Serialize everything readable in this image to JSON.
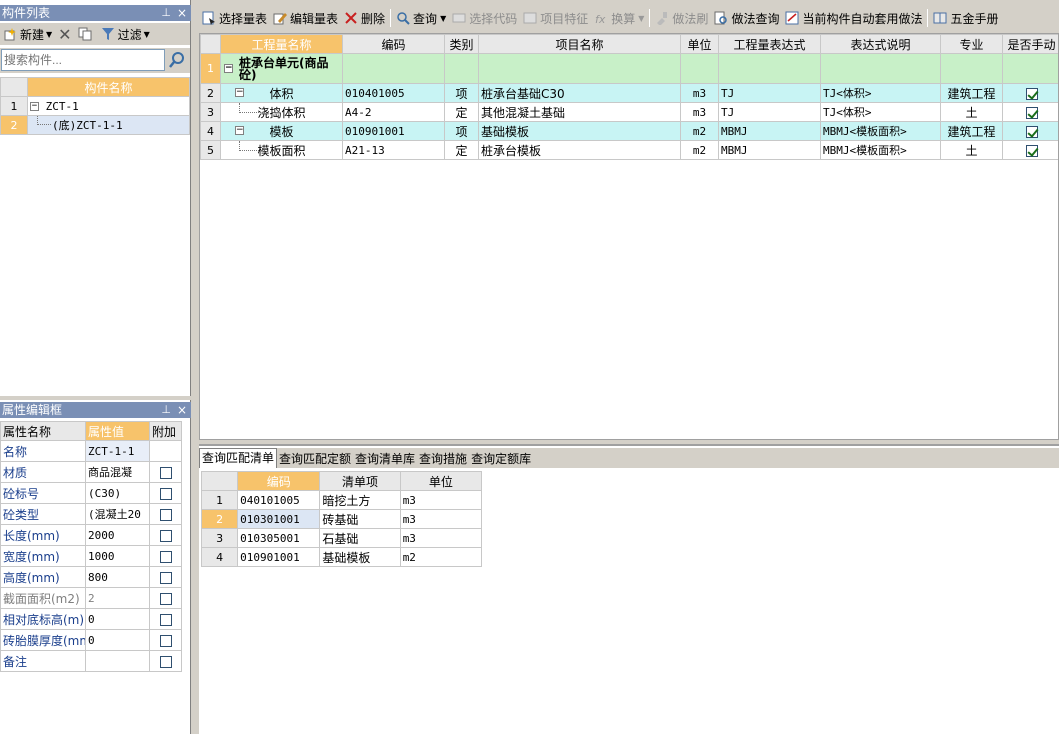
{
  "left_panel": {
    "title": "构件列表",
    "pin": "⊥",
    "close": "×",
    "toolbar": {
      "new_label": "新建",
      "filter_label": "过滤"
    },
    "search_placeholder": "搜索构件...",
    "column_header": "构件名称",
    "tree": [
      {
        "num": "1",
        "label": "ZCT-1"
      },
      {
        "num": "2",
        "label": "(底)ZCT-1-1"
      }
    ]
  },
  "prop_panel": {
    "title": "属性编辑框",
    "pin": "⊥",
    "close": "×",
    "headers": [
      "属性名称",
      "属性值",
      "附加"
    ],
    "rows": [
      {
        "name": "名称",
        "value": "ZCT-1-1",
        "has_check": false,
        "gray": false
      },
      {
        "name": "材质",
        "value": "商品混凝",
        "has_check": true,
        "gray": false
      },
      {
        "name": "砼标号",
        "value": "(C30)",
        "has_check": true,
        "gray": false
      },
      {
        "name": "砼类型",
        "value": "(混凝土20",
        "has_check": true,
        "gray": false
      },
      {
        "name": "长度(mm)",
        "value": "2000",
        "has_check": true,
        "gray": false
      },
      {
        "name": "宽度(mm)",
        "value": "1000",
        "has_check": true,
        "gray": false
      },
      {
        "name": "高度(mm)",
        "value": "800",
        "has_check": true,
        "gray": false
      },
      {
        "name": "截面面积(m2)",
        "value": "2",
        "has_check": true,
        "gray": true
      },
      {
        "name": "相对底标高(m)",
        "value": "0",
        "has_check": true,
        "gray": false
      },
      {
        "name": "砖胎膜厚度(mm",
        "value": "0",
        "has_check": true,
        "gray": false
      },
      {
        "name": "备注",
        "value": "",
        "has_check": true,
        "gray": false
      }
    ]
  },
  "main_toolbar": [
    {
      "label": "选择量表",
      "enabled": true,
      "icon": "select-table-icon"
    },
    {
      "label": "编辑量表",
      "enabled": true,
      "icon": "edit-table-icon"
    },
    {
      "label": "删除",
      "enabled": true,
      "icon": "delete-icon"
    },
    {
      "label": "查询",
      "enabled": true,
      "icon": "query-icon",
      "dropdown": true
    },
    {
      "label": "选择代码",
      "enabled": false,
      "icon": "select-code-icon"
    },
    {
      "label": "项目特征",
      "enabled": false,
      "icon": "feature-icon"
    },
    {
      "label": "换算",
      "enabled": false,
      "icon": "formula-icon",
      "dropdown": true
    },
    {
      "label": "做法刷",
      "enabled": false,
      "icon": "brush-icon"
    },
    {
      "label": "做法查询",
      "enabled": true,
      "icon": "method-query-icon"
    },
    {
      "label": "当前构件自动套用做法",
      "enabled": true,
      "icon": "auto-apply-icon"
    },
    {
      "label": "五金手册",
      "enabled": true,
      "icon": "manual-icon"
    }
  ],
  "main_grid": {
    "headers": [
      "工程量名称",
      "编码",
      "类别",
      "项目名称",
      "单位",
      "工程量表达式",
      "表达式说明",
      "专业",
      "是否手动"
    ],
    "rows": [
      {
        "num": "1",
        "name": "桩承台单元(商品砼)",
        "code": "",
        "type": "",
        "project": "",
        "unit": "",
        "expr": "",
        "desc": "",
        "major": "",
        "manual": null,
        "kind": "group"
      },
      {
        "num": "2",
        "name": "体积",
        "code": "010401005",
        "type": "项",
        "project": "桩承台基础C30",
        "unit": "m3",
        "expr": "TJ",
        "desc": "TJ<体积>",
        "major": "建筑工程",
        "manual": true,
        "kind": "item"
      },
      {
        "num": "3",
        "name": "浇捣体积",
        "code": "A4-2",
        "type": "定",
        "project": "其他混凝土基础",
        "unit": "m3",
        "expr": "TJ",
        "desc": "TJ<体积>",
        "major": "土",
        "manual": true,
        "kind": "sub"
      },
      {
        "num": "4",
        "name": "模板",
        "code": "010901001",
        "type": "项",
        "project": "基础模板",
        "unit": "m2",
        "expr": "MBMJ",
        "desc": "MBMJ<模板面积>",
        "major": "建筑工程",
        "manual": true,
        "kind": "item"
      },
      {
        "num": "5",
        "name": "模板面积",
        "code": "A21-13",
        "type": "定",
        "project": "桩承台模板",
        "unit": "m2",
        "expr": "MBMJ",
        "desc": "MBMJ<模板面积>",
        "major": "土",
        "manual": true,
        "kind": "sub"
      }
    ]
  },
  "bottom_tabs": [
    "查询匹配清单",
    "查询匹配定额",
    "查询清单库",
    "查询措施",
    "查询定额库"
  ],
  "bottom_grid": {
    "headers": [
      "编码",
      "清单项",
      "单位"
    ],
    "rows": [
      {
        "num": "1",
        "code": "040101005",
        "name": "暗挖土方",
        "unit": "m3"
      },
      {
        "num": "2",
        "code": "010301001",
        "name": "砖基础",
        "unit": "m3"
      },
      {
        "num": "3",
        "code": "010305001",
        "name": "石基础",
        "unit": "m3"
      },
      {
        "num": "4",
        "code": "010901001",
        "name": "基础模板",
        "unit": "m2"
      }
    ]
  }
}
